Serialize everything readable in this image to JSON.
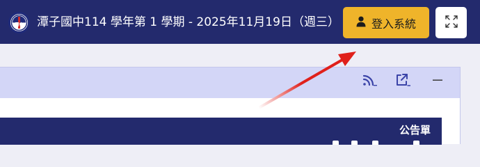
{
  "header": {
    "school_logo_text": "潭中",
    "title": "潭子國中114 學年第 1 學期 - 2025年11月19日（週三）",
    "login_label": "登入系統"
  },
  "panel": {
    "announcement_title": "公告單"
  },
  "colors": {
    "navbar": "#232a6d",
    "login_button": "#efb42a",
    "panel_header": "#d3d6f7",
    "annotation_arrow": "#e0201b"
  },
  "icons": {
    "logo": "school-logo",
    "login": "user-icon",
    "fullscreen": "fullscreen-icon",
    "rss": "rss-icon",
    "open": "external-link-icon",
    "minimize": "minimize-icon"
  }
}
